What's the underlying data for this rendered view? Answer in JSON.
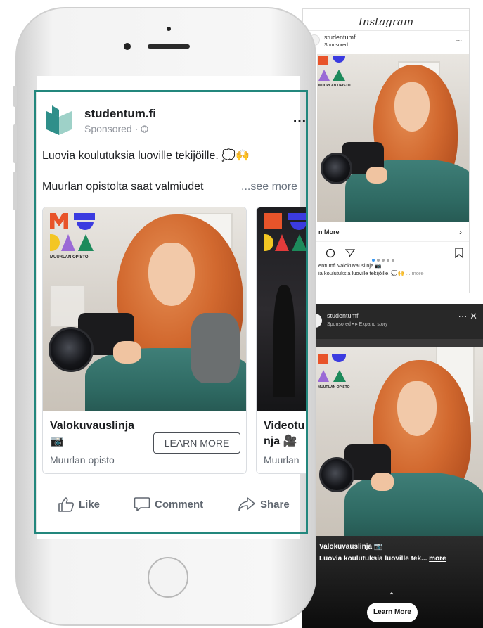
{
  "facebook": {
    "page_name": "studentum.fi",
    "sponsored_label": "Sponsored",
    "globe_icon": "globe-icon",
    "more_icon": "…",
    "primary_text_line1": "Luovia koulutuksia luoville tekijöille. 💭🙌",
    "primary_text_line2": "Muurlan opistolta saat valmiudet",
    "see_more": "...see more",
    "carousel": [
      {
        "title_line1": "Valokuvauslinja",
        "title_line2": "📷",
        "subtitle": "Muurlan opisto",
        "cta": "LEARN MORE",
        "logo_caption": "MUURLAN OPISTO"
      },
      {
        "title_line1": "Videotu",
        "title_line2": "nja 🎥",
        "subtitle": "Muurlan"
      }
    ],
    "actions": {
      "like": "Like",
      "comment": "Comment",
      "share": "Share"
    }
  },
  "instagram": {
    "brand": "Instagram",
    "username": "studentumfi",
    "sponsored": "Sponsored",
    "more_icon": "...",
    "learn_more": "n More",
    "chevron": "›",
    "caption_line1": "entumfi Valokuvauslinja 📷",
    "caption_line2": "ia koulutuksia luoville tekijöille. 💭🙌",
    "caption_more": "... more",
    "logo_caption": "MUURLAN OPISTO"
  },
  "story": {
    "username": "studentumfi",
    "sponsored": "Sponsored • ▸ Expand story",
    "controls": "···  ✕",
    "title_line": "Valokuvauslinja 📷",
    "caption": "Luovia koulutuksia luoville tek...",
    "caption_more": "more",
    "caret": "⌃",
    "cta": "Learn More",
    "logo_caption": "MUURLAN OPISTO"
  },
  "colors": {
    "highlight_border": "#23877d",
    "logo_orange": "#e8542a",
    "logo_blue": "#3b3be0",
    "logo_purple": "#9a6ad6",
    "logo_yellow": "#f3c623",
    "logo_green": "#1d8a5b",
    "logo_red": "#e23b3b"
  }
}
